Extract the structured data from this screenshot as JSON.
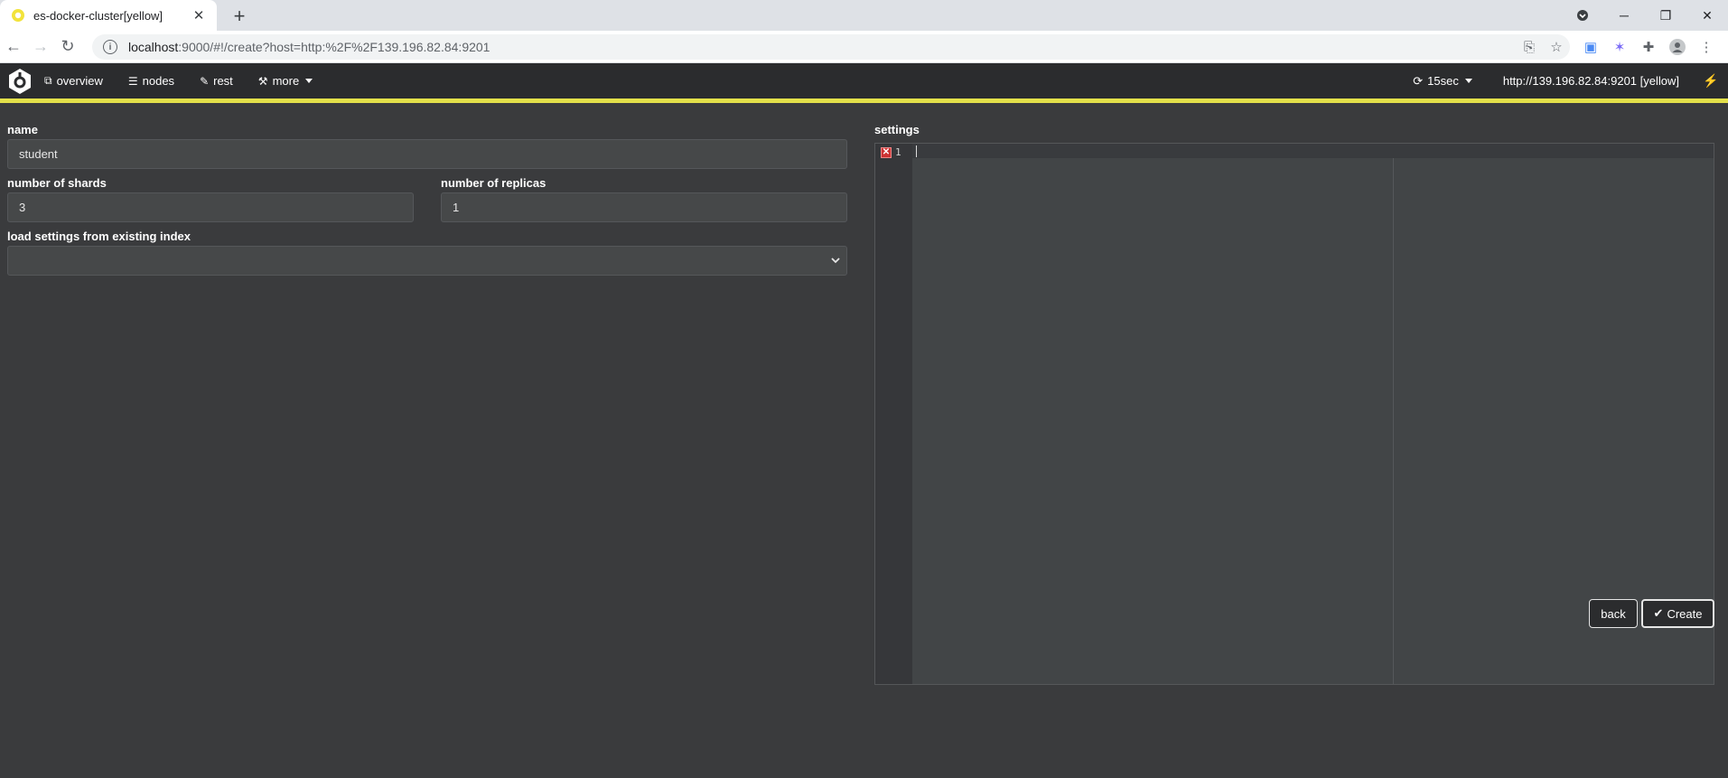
{
  "browser": {
    "tab_title": "es-docker-cluster[yellow]",
    "url_host": "localhost",
    "url_rest": ":9000/#!/create?host=http:%2F%2F139.196.82.84:9201"
  },
  "nav": {
    "overview": "overview",
    "nodes": "nodes",
    "rest": "rest",
    "more": "more",
    "refresh": "15sec",
    "host": "http://139.196.82.84:9201 [yellow]"
  },
  "form": {
    "name_label": "name",
    "name_value": "student",
    "shards_label": "number of shards",
    "shards_value": "3",
    "replicas_label": "number of replicas",
    "replicas_value": "1",
    "load_label": "load settings from existing index",
    "load_value": "",
    "settings_label": "settings",
    "editor_line": "1"
  },
  "buttons": {
    "back": "back",
    "create": "Create"
  },
  "colors": {
    "accent_yellow": "#e3e04a",
    "nav_bg": "#2b2c2e",
    "page_bg": "#3a3b3d"
  },
  "icons": [
    "info-icon",
    "translate-icon",
    "star-icon",
    "extension-icon",
    "profile-icon",
    "menu-icon",
    "sitemap-icon",
    "list-icon",
    "edit-icon",
    "magic-icon",
    "refresh-icon",
    "plug-icon",
    "check-icon"
  ]
}
